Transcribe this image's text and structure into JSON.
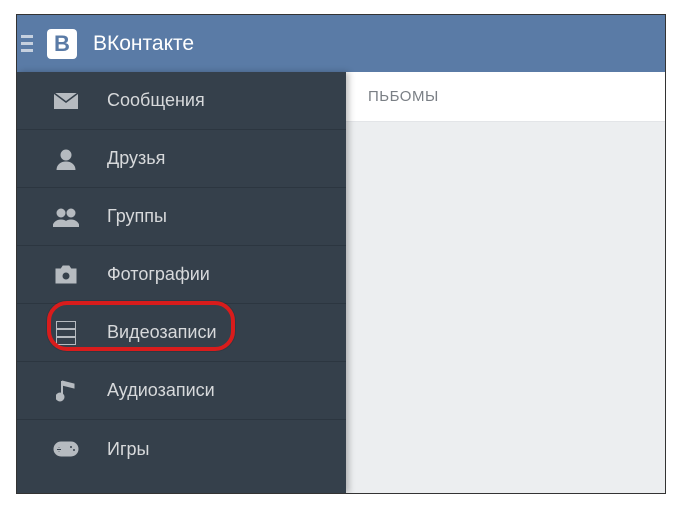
{
  "header": {
    "title": "ВКонтакте"
  },
  "main": {
    "tab": "ПЬБОМЫ"
  },
  "sidebar": {
    "items": [
      {
        "label": "Сообщения"
      },
      {
        "label": "Друзья"
      },
      {
        "label": "Группы"
      },
      {
        "label": "Фотографии"
      },
      {
        "label": "Видеозаписи"
      },
      {
        "label": "Аудиозаписи"
      },
      {
        "label": "Игры"
      }
    ]
  }
}
